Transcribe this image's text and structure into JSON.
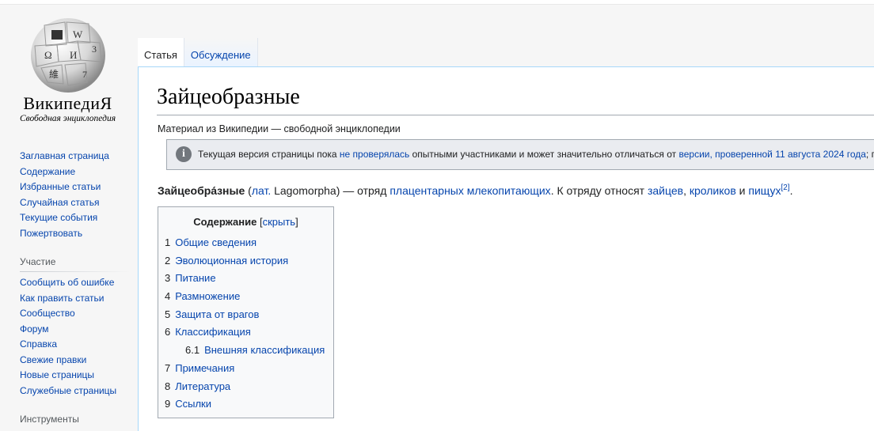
{
  "logo": {
    "wordmark": "ВикипедиЯ",
    "tagline": "Свободная энциклопедия"
  },
  "sidebar": {
    "navigation": [
      "Заглавная страница",
      "Содержание",
      "Избранные статьи",
      "Случайная статья",
      "Текущие события",
      "Пожертвовать"
    ],
    "participation_heading": "Участие",
    "participation": [
      "Сообщить об ошибке",
      "Как править статьи",
      "Сообщество",
      "Форум",
      "Справка",
      "Свежие правки",
      "Новые страницы",
      "Служебные страницы"
    ],
    "tools_heading": "Инструменты"
  },
  "tabs": {
    "article": "Статья",
    "talk": "Обсуждение"
  },
  "article": {
    "title": "Зайцеобразные",
    "site_sub": "Материал из Википедии — свободной энциклопедии",
    "notice": {
      "part1": "Текущая версия страницы пока ",
      "link1": "не проверялась",
      "part2": " опытными участниками и может значительно отличаться от ",
      "link2": "версии, проверенной 11 августа 2024 года",
      "part3": "; пров"
    },
    "lead": {
      "term": "Зайцеобра́зные",
      "open_paren": " (",
      "lat_link": "лат.",
      "latin_name": " Lagomorpha) — отряд ",
      "link_placental": "плацентарных млекопитающих",
      "mid": ". К отряду относят ",
      "link_hares": "зайцев",
      "comma": ", ",
      "link_rabbits": "кроликов",
      "and": " и ",
      "link_pikas": "пищух",
      "ref": "[2]",
      "end": "."
    }
  },
  "toc": {
    "title": "Содержание",
    "toggle_open": " [",
    "toggle": "скрыть",
    "toggle_close": "]",
    "items": [
      {
        "num": "1",
        "label": "Общие сведения"
      },
      {
        "num": "2",
        "label": "Эволюционная история"
      },
      {
        "num": "3",
        "label": "Питание"
      },
      {
        "num": "4",
        "label": "Размножение"
      },
      {
        "num": "5",
        "label": "Защита от врагов"
      },
      {
        "num": "6",
        "label": "Классификация"
      },
      {
        "num": "6.1",
        "label": "Внешняя классификация"
      },
      {
        "num": "7",
        "label": "Примечания"
      },
      {
        "num": "8",
        "label": "Литература"
      },
      {
        "num": "9",
        "label": "Ссылки"
      }
    ]
  }
}
